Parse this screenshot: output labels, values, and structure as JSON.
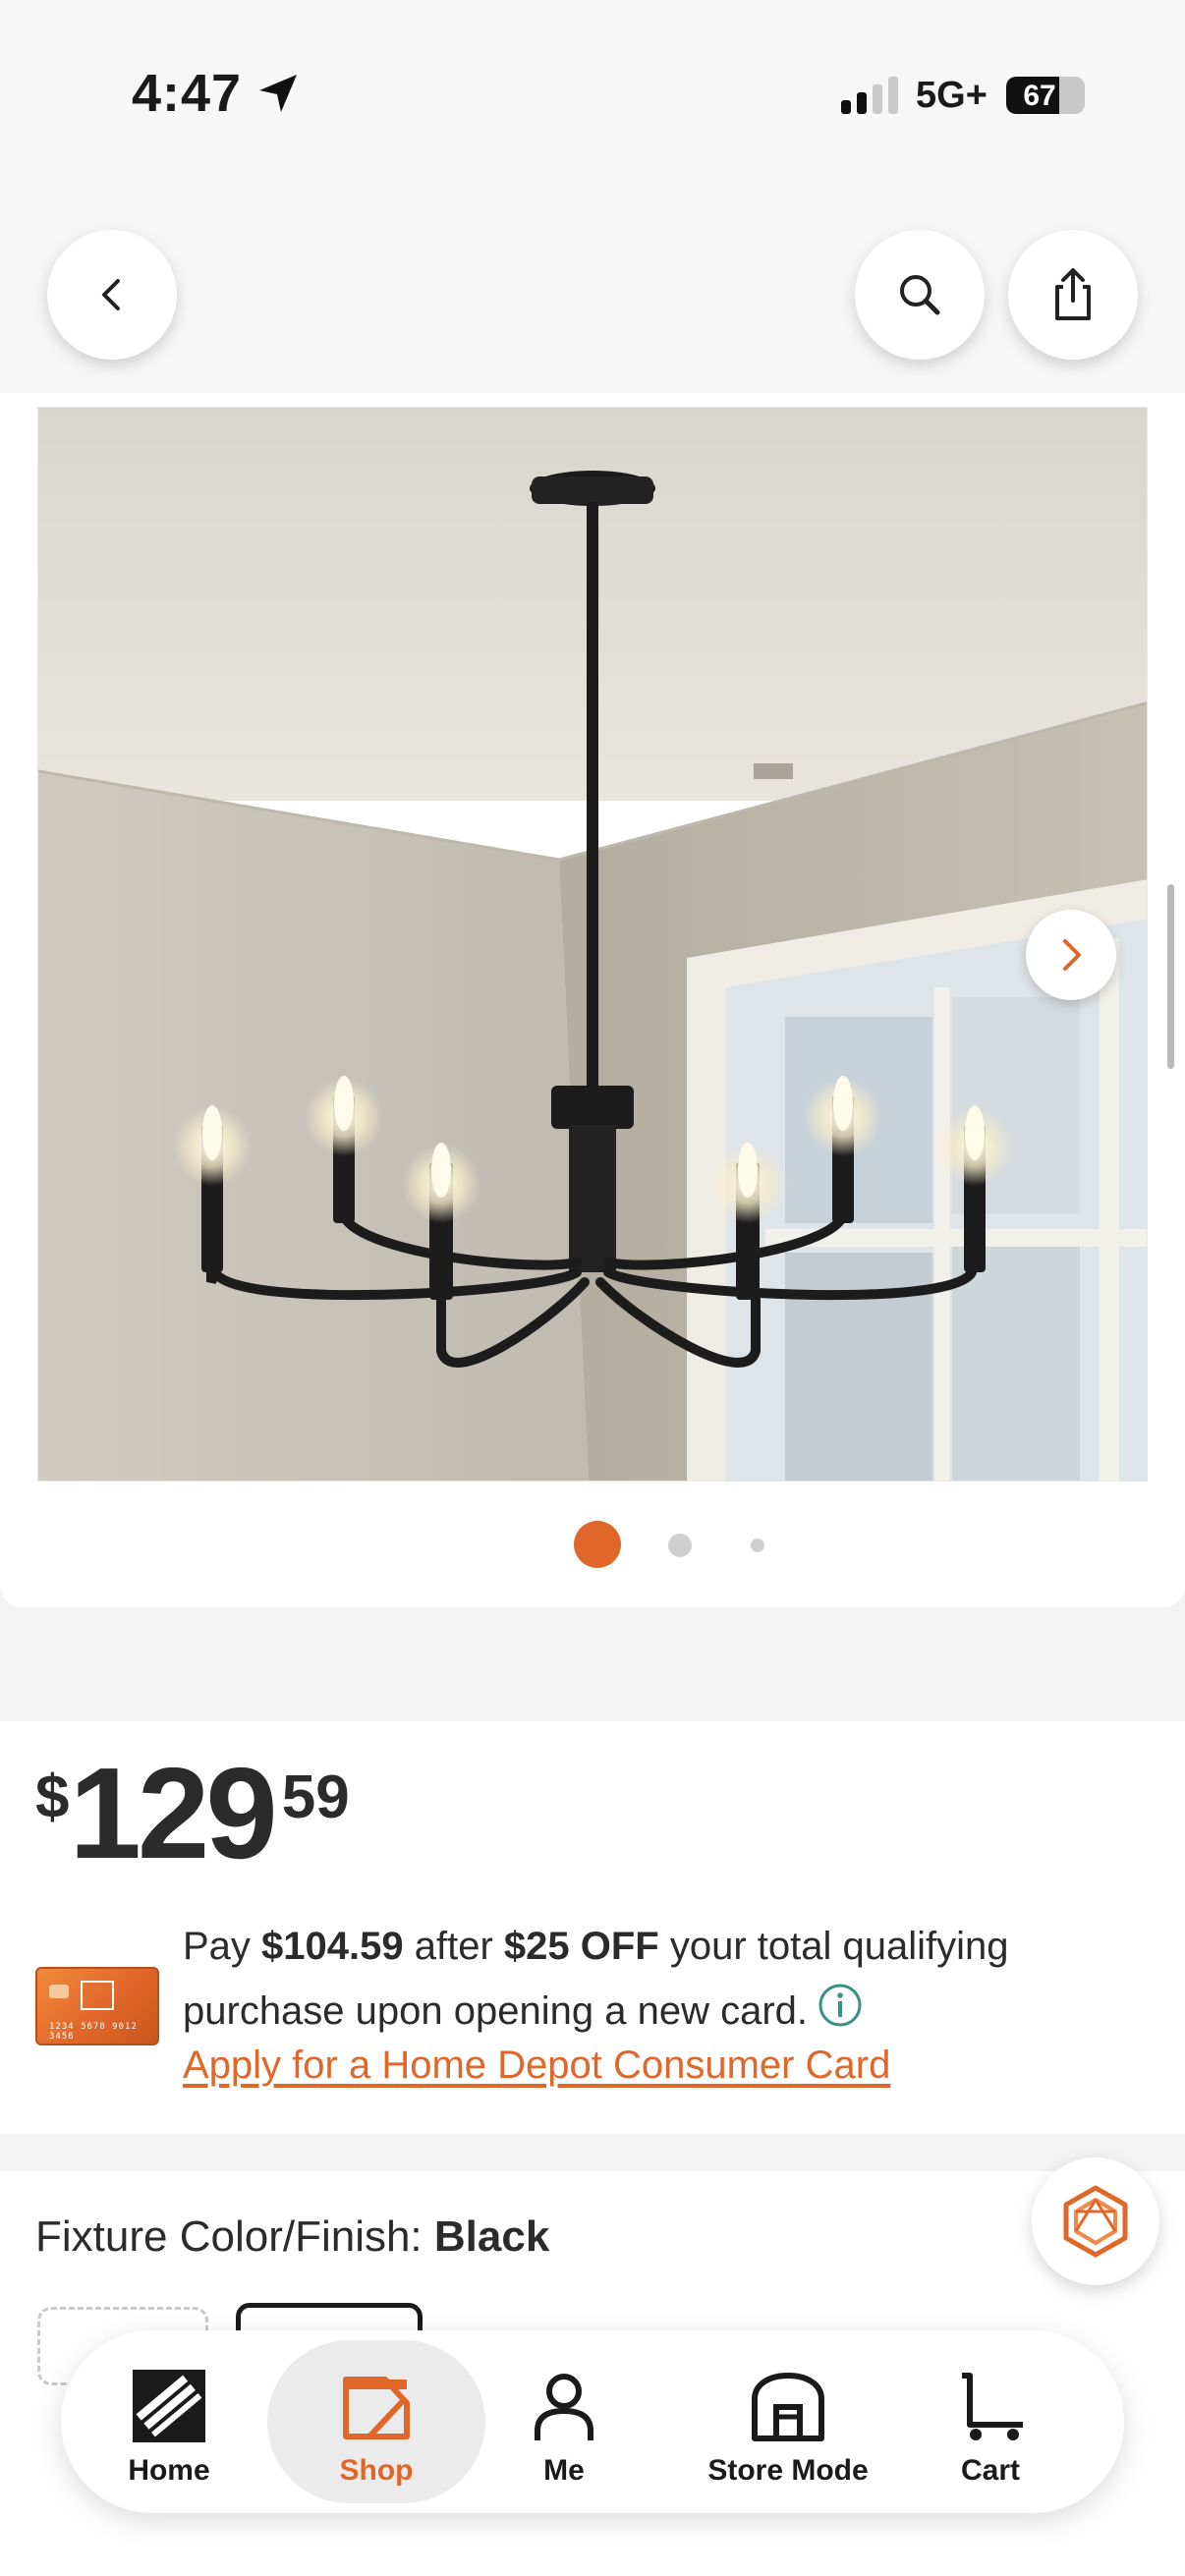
{
  "status_bar": {
    "time": "4:47",
    "network": "5G+",
    "battery_percent": "67",
    "battery_level": 0.67,
    "signal_bars_active": 2,
    "signal_bars_total": 4
  },
  "header": {
    "back_icon": "chevron-left-icon",
    "search_icon": "search-icon",
    "share_icon": "share-icon"
  },
  "gallery": {
    "image_count": 3,
    "active_index": 0,
    "next_icon": "chevron-right-icon"
  },
  "price": {
    "currency": "$",
    "dollars": "129",
    "cents": "59"
  },
  "promo": {
    "pay_prefix": "Pay ",
    "pay_amount": "$104.59",
    "after_text": " after ",
    "discount": "$25 OFF",
    "rest_text": " your total qualifying purchase upon opening a new card.",
    "apply_link": "Apply for a Home Depot Consumer Card",
    "card_number": "1234 5678 9012 3456"
  },
  "fixture": {
    "label": "Fixture Color/Finish: ",
    "value": "Black"
  },
  "nav": {
    "items": [
      {
        "label": "Home",
        "icon": "home-depot-logo-icon"
      },
      {
        "label": "Shop",
        "icon": "shop-icon"
      },
      {
        "label": "Me",
        "icon": "user-icon"
      },
      {
        "label": "Store Mode",
        "icon": "store-icon"
      },
      {
        "label": "Cart",
        "icon": "cart-icon"
      }
    ],
    "active": "Shop"
  },
  "colors": {
    "accent": "#e0672a",
    "teal_info": "#3a8f8a"
  }
}
